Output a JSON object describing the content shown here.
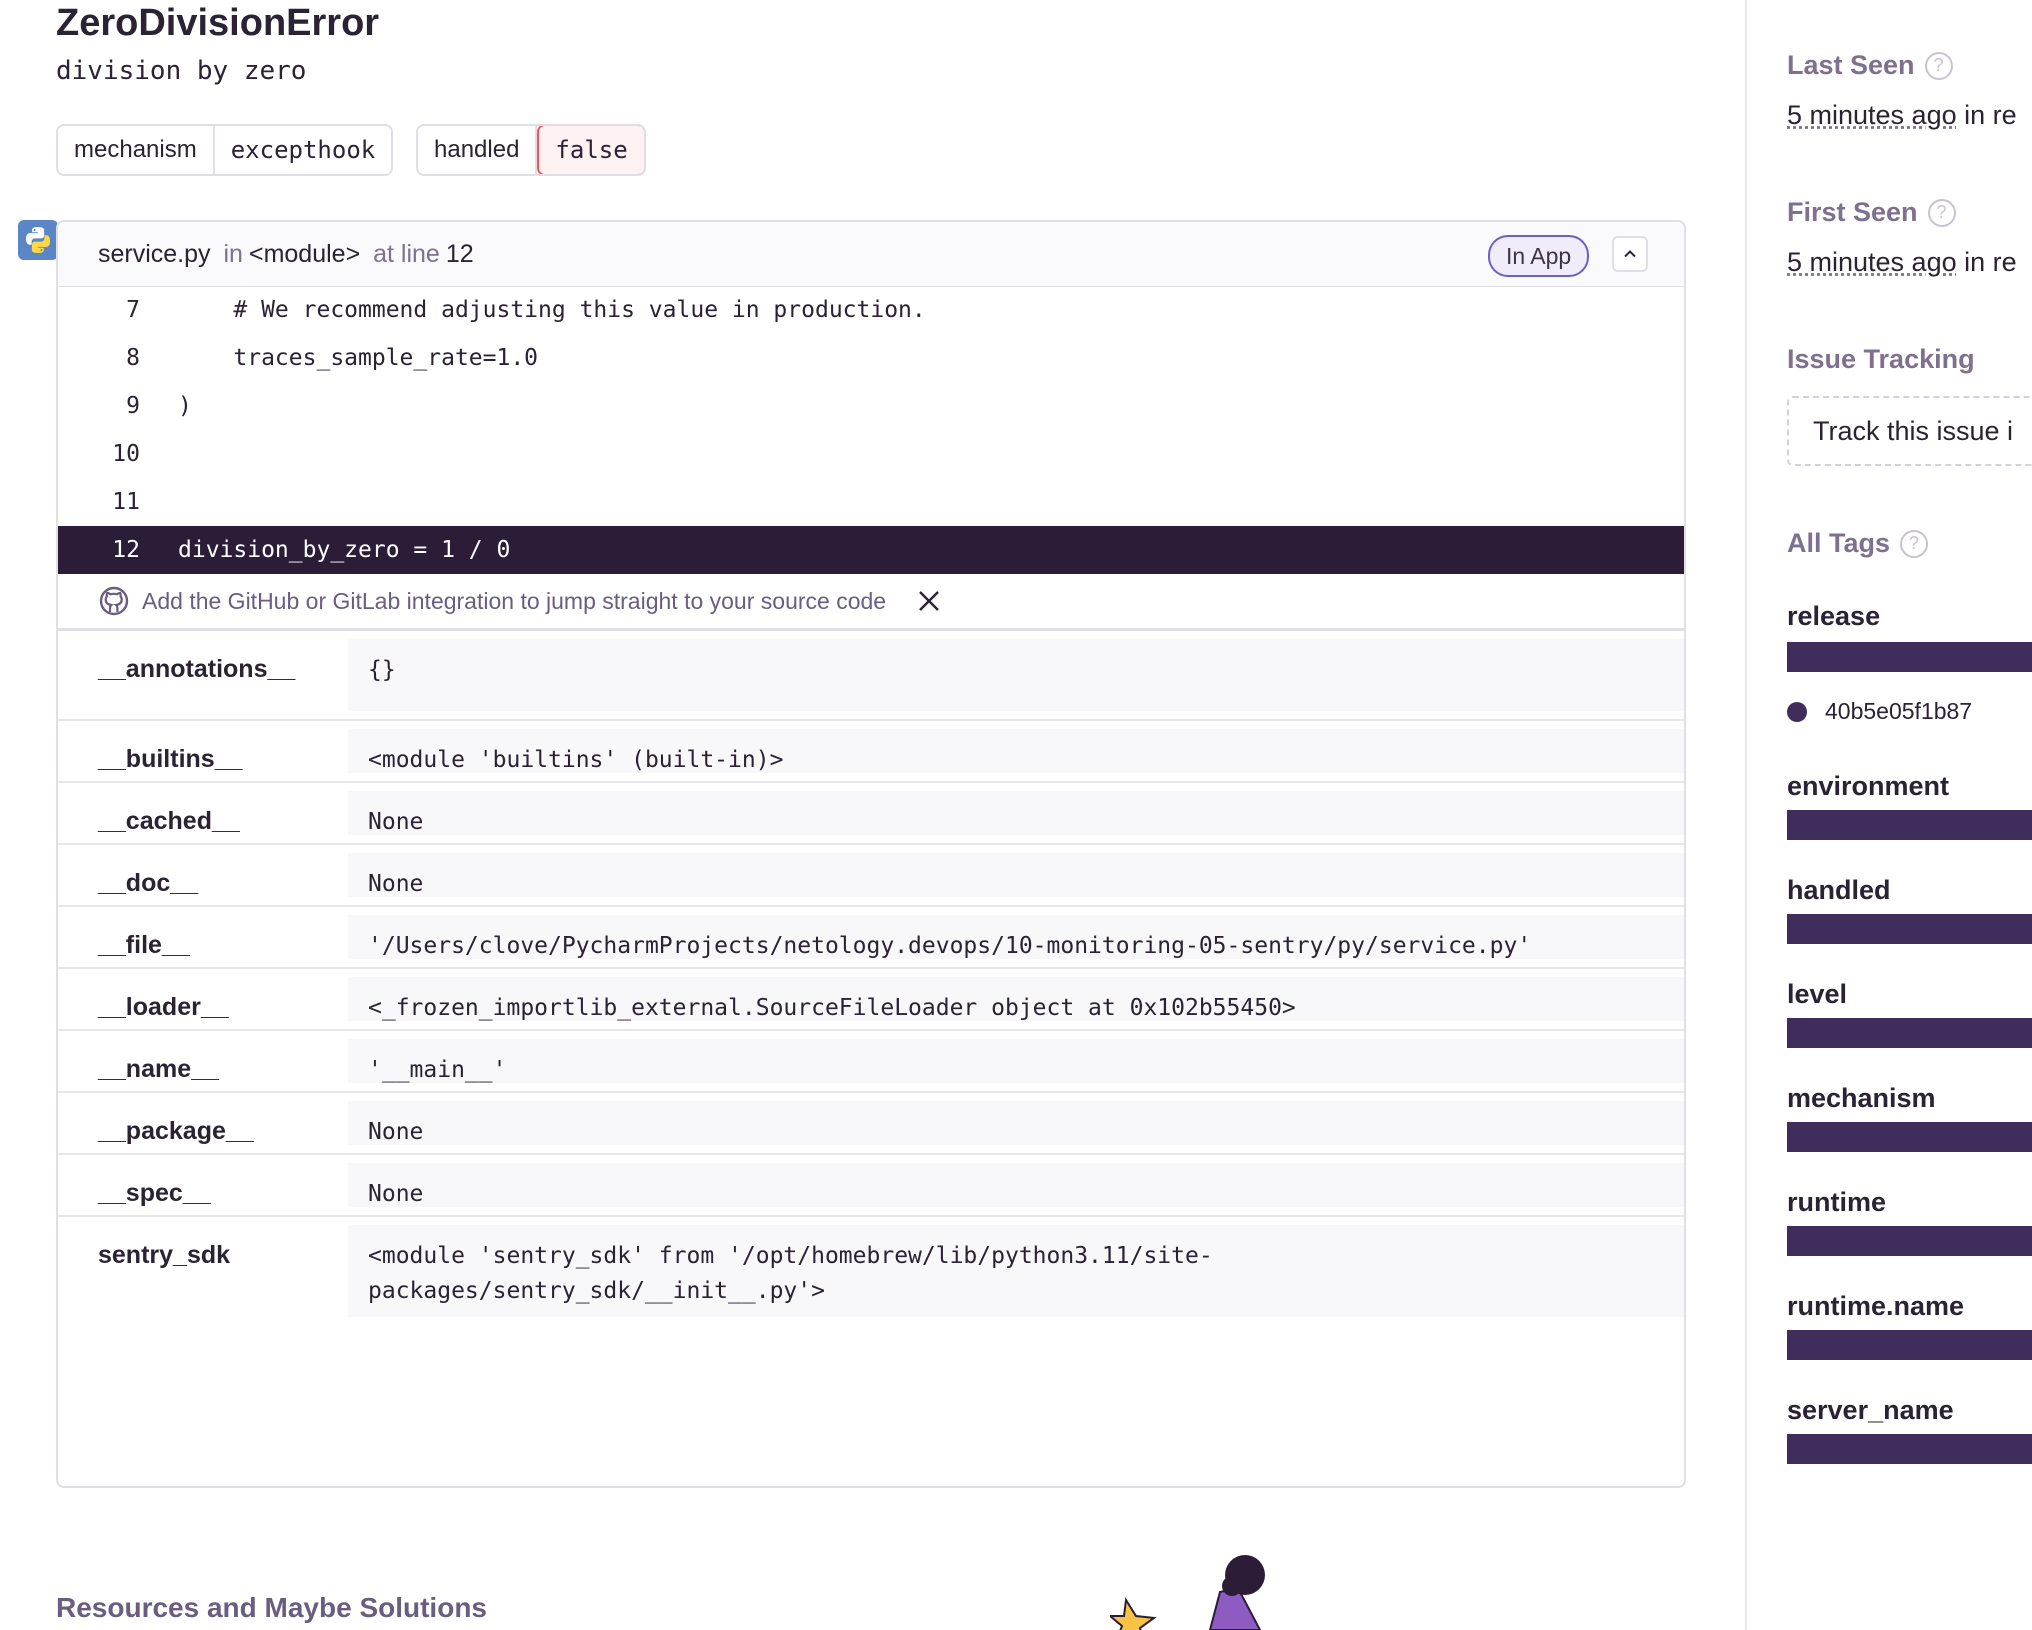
{
  "exception": {
    "type": "ZeroDivisionError",
    "message": "division by zero",
    "tags": [
      {
        "key": "mechanism",
        "value": "excepthook"
      },
      {
        "key": "handled",
        "value": "false"
      }
    ]
  },
  "frame": {
    "file": "service.py",
    "in_word": "in",
    "function": "<module>",
    "at_line_word": "at line",
    "line_no": "12",
    "in_app_label": "In App",
    "code_lines": [
      {
        "ln": "7",
        "src": "    # We recommend adjusting this value in production."
      },
      {
        "ln": "8",
        "src": "    traces_sample_rate=1.0"
      },
      {
        "ln": "9",
        "src": ")"
      },
      {
        "ln": "10",
        "src": ""
      },
      {
        "ln": "11",
        "src": ""
      },
      {
        "ln": "12",
        "src": "division_by_zero = 1 / 0"
      }
    ],
    "integration_notice": "Add the GitHub or GitLab integration to jump straight to your source code",
    "variables": [
      {
        "key": "__annotations__",
        "value": "{}"
      },
      {
        "key": "__builtins__",
        "value": "<module 'builtins' (built-in)>"
      },
      {
        "key": "__cached__",
        "value": "None"
      },
      {
        "key": "__doc__",
        "value": "None"
      },
      {
        "key": "__file__",
        "value": "'/Users/clove/PycharmProjects/netology.devops/10-monitoring-05-sentry/py/service.py'"
      },
      {
        "key": "__loader__",
        "value": "<_frozen_importlib_external.SourceFileLoader object at 0x102b55450>"
      },
      {
        "key": "__name__",
        "value": "'__main__'"
      },
      {
        "key": "__package__",
        "value": "None"
      },
      {
        "key": "__spec__",
        "value": "None"
      },
      {
        "key": "sentry_sdk",
        "value": "<module 'sentry_sdk' from '/opt/homebrew/lib/python3.11/site-\npackages/sentry_sdk/__init__.py'>"
      }
    ]
  },
  "resources_title": "Resources and Maybe Solutions",
  "sidebar": {
    "last_seen_label": "Last Seen",
    "last_seen_value": "5 minutes ago",
    "last_seen_suffix": "in re",
    "first_seen_label": "First Seen",
    "first_seen_value": "5 minutes ago",
    "first_seen_suffix": "in re",
    "issue_tracking_label": "Issue Tracking",
    "track_issue_text": "Track this issue i",
    "all_tags_label": "All Tags",
    "tags": [
      "release",
      "environment",
      "handled",
      "level",
      "mechanism",
      "runtime",
      "runtime.name",
      "server_name"
    ],
    "release_value": "40b5e05f1b87"
  },
  "colors": {
    "accent": "#6c5fc7",
    "tag_bar": "#3f2d5c",
    "active_line": "#2b1d38",
    "danger": "#f55459"
  }
}
